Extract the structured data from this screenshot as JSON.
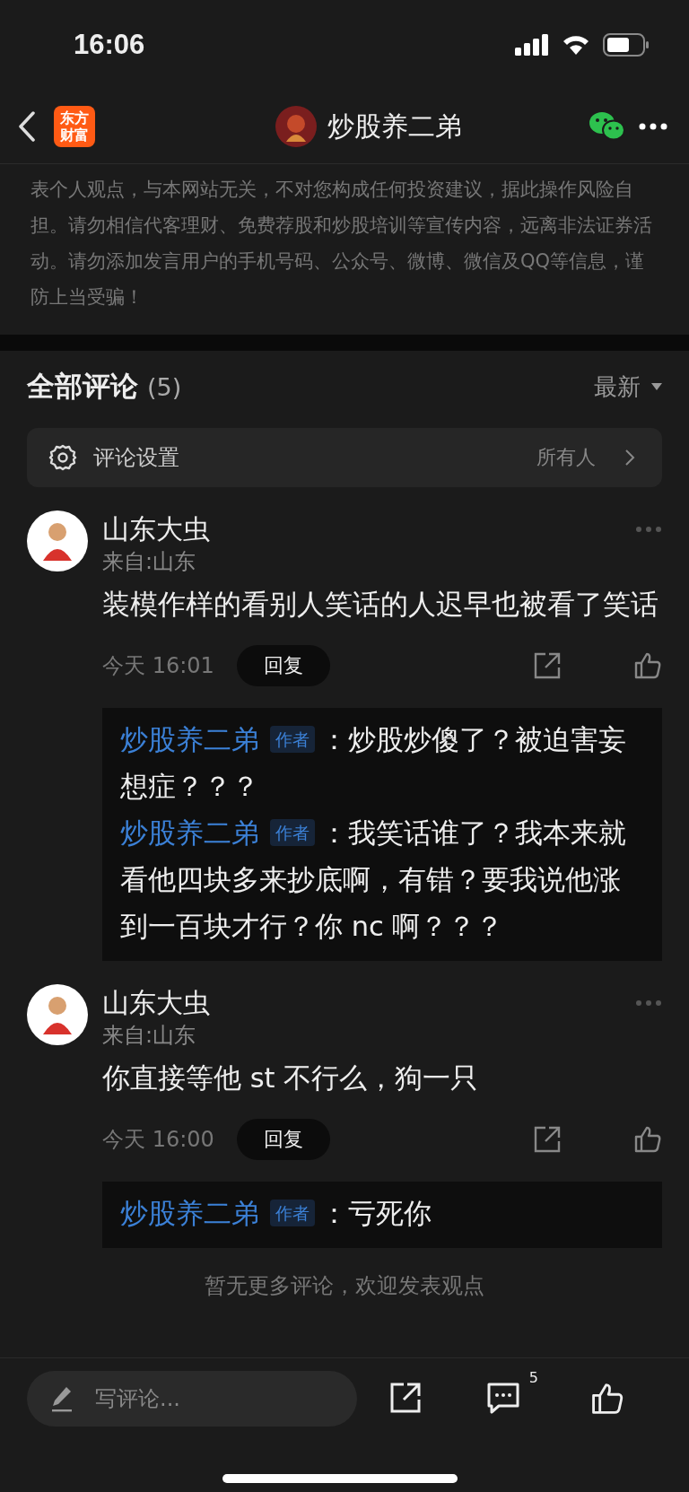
{
  "status_bar": {
    "time": "16:06"
  },
  "nav": {
    "logo_lines": [
      "东方",
      "财富"
    ],
    "title": "炒股养二弟"
  },
  "disclaimer": "表个人观点，与本网站无关，不对您构成任何投资建议，据此操作风险自担。请勿相信代客理财、免费荐股和炒股培训等宣传内容，远离非法证券活动。请勿添加发言用户的手机号码、公众号、微博、微信及QQ等信息，谨防上当受骗！",
  "comments_header": {
    "title": "全部评论",
    "count": "(5)",
    "sort": "最新"
  },
  "comment_settings": {
    "label": "评论设置",
    "value": "所有人"
  },
  "comments": [
    {
      "name": "山东大虫",
      "location": "来自:山东",
      "text": "装模作样的看别人笑话的人迟早也被看了笑话",
      "time": "今天 16:01",
      "reply_label": "回复",
      "replies": [
        {
          "author": "炒股养二弟",
          "badge": "作者",
          "text": "：炒股炒傻了？被迫害妄想症？？？"
        },
        {
          "author": "炒股养二弟",
          "badge": "作者",
          "text": "：我笑话谁了？我本来就看他四块多来抄底啊，有错？要我说他涨到一百块才行？你 nc 啊？？？"
        }
      ]
    },
    {
      "name": "山东大虫",
      "location": "来自:山东",
      "text": "你直接等他 st 不行么，狗一只",
      "time": "今天 16:00",
      "reply_label": "回复",
      "replies": [
        {
          "author": "炒股养二弟",
          "badge": "作者",
          "text": "：亏死你"
        }
      ]
    }
  ],
  "footer_note": "暂无更多评论，欢迎发表观点",
  "bottom_bar": {
    "placeholder": "写评论...",
    "comment_count": "5"
  }
}
